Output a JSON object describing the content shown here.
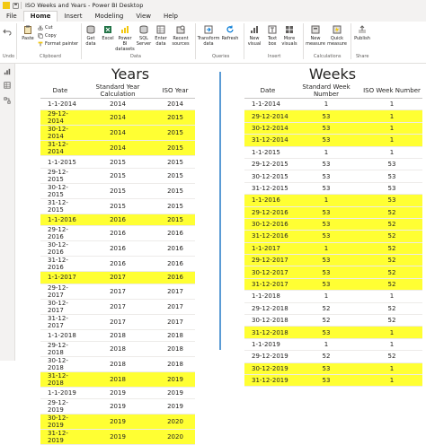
{
  "window": {
    "title": "ISO Weeks and Years - Power BI Desktop"
  },
  "tabs": [
    {
      "label": "File"
    },
    {
      "label": "Home"
    },
    {
      "label": "Insert"
    },
    {
      "label": "Modeling"
    },
    {
      "label": "View"
    },
    {
      "label": "Help"
    }
  ],
  "ribbon": {
    "undo_label": "Undo",
    "paste_label": "Paste",
    "cut_label": "Cut",
    "copy_label": "Copy",
    "format_painter_label": "Format painter",
    "get_data_label": "Get data",
    "excel_label": "Excel",
    "powerbi_datasets_label": "Power BI datasets",
    "sql_server_label": "SQL Server",
    "enter_data_label": "Enter data",
    "recent_sources_label": "Recent sources",
    "transform_data_label": "Transform data",
    "refresh_label": "Refresh",
    "new_visual_label": "New visual",
    "text_box_label": "Text box",
    "more_visuals_label": "More visuals",
    "new_measure_label": "New measure",
    "quick_measure_label": "Quick measure",
    "publish_label": "Publish",
    "groups": {
      "undo": "Undo",
      "clipboard": "Clipboard",
      "data": "Data",
      "queries": "Queries",
      "insert": "Insert",
      "calculations": "Calculations",
      "share": "Share"
    }
  },
  "years": {
    "heading": "Years",
    "columns": [
      "Date",
      "Standard Year Calculation",
      "ISO Year"
    ],
    "rows": [
      {
        "date": "1-1-2014",
        "std": "2014",
        "iso": "2014",
        "hl": false
      },
      {
        "date": "29-12-2014",
        "std": "2014",
        "iso": "2015",
        "hl": true
      },
      {
        "date": "30-12-2014",
        "std": "2014",
        "iso": "2015",
        "hl": true
      },
      {
        "date": "31-12-2014",
        "std": "2014",
        "iso": "2015",
        "hl": true
      },
      {
        "date": "1-1-2015",
        "std": "2015",
        "iso": "2015",
        "hl": false
      },
      {
        "date": "29-12-2015",
        "std": "2015",
        "iso": "2015",
        "hl": false
      },
      {
        "date": "30-12-2015",
        "std": "2015",
        "iso": "2015",
        "hl": false
      },
      {
        "date": "31-12-2015",
        "std": "2015",
        "iso": "2015",
        "hl": false
      },
      {
        "date": "1-1-2016",
        "std": "2016",
        "iso": "2015",
        "hl": true
      },
      {
        "date": "29-12-2016",
        "std": "2016",
        "iso": "2016",
        "hl": false
      },
      {
        "date": "30-12-2016",
        "std": "2016",
        "iso": "2016",
        "hl": false
      },
      {
        "date": "31-12-2016",
        "std": "2016",
        "iso": "2016",
        "hl": false
      },
      {
        "date": "1-1-2017",
        "std": "2017",
        "iso": "2016",
        "hl": true
      },
      {
        "date": "29-12-2017",
        "std": "2017",
        "iso": "2017",
        "hl": false
      },
      {
        "date": "30-12-2017",
        "std": "2017",
        "iso": "2017",
        "hl": false
      },
      {
        "date": "31-12-2017",
        "std": "2017",
        "iso": "2017",
        "hl": false
      },
      {
        "date": "1-1-2018",
        "std": "2018",
        "iso": "2018",
        "hl": false
      },
      {
        "date": "29-12-2018",
        "std": "2018",
        "iso": "2018",
        "hl": false
      },
      {
        "date": "30-12-2018",
        "std": "2018",
        "iso": "2018",
        "hl": false
      },
      {
        "date": "31-12-2018",
        "std": "2018",
        "iso": "2019",
        "hl": true
      },
      {
        "date": "1-1-2019",
        "std": "2019",
        "iso": "2019",
        "hl": false
      },
      {
        "date": "29-12-2019",
        "std": "2019",
        "iso": "2019",
        "hl": false
      },
      {
        "date": "30-12-2019",
        "std": "2019",
        "iso": "2020",
        "hl": true
      },
      {
        "date": "31-12-2019",
        "std": "2019",
        "iso": "2020",
        "hl": true
      }
    ]
  },
  "weeks": {
    "heading": "Weeks",
    "columns": [
      "Date",
      "Standard Week Number",
      "ISO Week Number"
    ],
    "rows": [
      {
        "date": "1-1-2014",
        "std": "1",
        "iso": "1",
        "hl": false
      },
      {
        "date": "29-12-2014",
        "std": "53",
        "iso": "1",
        "hl": true
      },
      {
        "date": "30-12-2014",
        "std": "53",
        "iso": "1",
        "hl": true
      },
      {
        "date": "31-12-2014",
        "std": "53",
        "iso": "1",
        "hl": true
      },
      {
        "date": "1-1-2015",
        "std": "1",
        "iso": "1",
        "hl": false
      },
      {
        "date": "29-12-2015",
        "std": "53",
        "iso": "53",
        "hl": false
      },
      {
        "date": "30-12-2015",
        "std": "53",
        "iso": "53",
        "hl": false
      },
      {
        "date": "31-12-2015",
        "std": "53",
        "iso": "53",
        "hl": false
      },
      {
        "date": "1-1-2016",
        "std": "1",
        "iso": "53",
        "hl": true
      },
      {
        "date": "29-12-2016",
        "std": "53",
        "iso": "52",
        "hl": true
      },
      {
        "date": "30-12-2016",
        "std": "53",
        "iso": "52",
        "hl": true
      },
      {
        "date": "31-12-2016",
        "std": "53",
        "iso": "52",
        "hl": true
      },
      {
        "date": "1-1-2017",
        "std": "1",
        "iso": "52",
        "hl": true
      },
      {
        "date": "29-12-2017",
        "std": "53",
        "iso": "52",
        "hl": true
      },
      {
        "date": "30-12-2017",
        "std": "53",
        "iso": "52",
        "hl": true
      },
      {
        "date": "31-12-2017",
        "std": "53",
        "iso": "52",
        "hl": true
      },
      {
        "date": "1-1-2018",
        "std": "1",
        "iso": "1",
        "hl": false
      },
      {
        "date": "29-12-2018",
        "std": "52",
        "iso": "52",
        "hl": false
      },
      {
        "date": "30-12-2018",
        "std": "52",
        "iso": "52",
        "hl": false
      },
      {
        "date": "31-12-2018",
        "std": "53",
        "iso": "1",
        "hl": true
      },
      {
        "date": "1-1-2019",
        "std": "1",
        "iso": "1",
        "hl": false
      },
      {
        "date": "29-12-2019",
        "std": "52",
        "iso": "52",
        "hl": false
      },
      {
        "date": "30-12-2019",
        "std": "53",
        "iso": "1",
        "hl": true
      },
      {
        "date": "31-12-2019",
        "std": "53",
        "iso": "1",
        "hl": true
      }
    ]
  },
  "colors": {
    "highlight": "#ffff33",
    "divider": "#5b9bd5",
    "accent": "#f2c811"
  },
  "icons": [
    "undo-icon",
    "paste-icon",
    "cut-icon",
    "copy-icon",
    "format-painter-icon",
    "get-data-icon",
    "excel-icon",
    "powerbi-datasets-icon",
    "sql-server-icon",
    "enter-data-icon",
    "recent-sources-icon",
    "transform-data-icon",
    "refresh-icon",
    "new-visual-icon",
    "text-box-icon",
    "more-visuals-icon",
    "new-measure-icon",
    "quick-measure-icon",
    "publish-icon",
    "report-view-icon",
    "data-view-icon",
    "model-view-icon"
  ]
}
